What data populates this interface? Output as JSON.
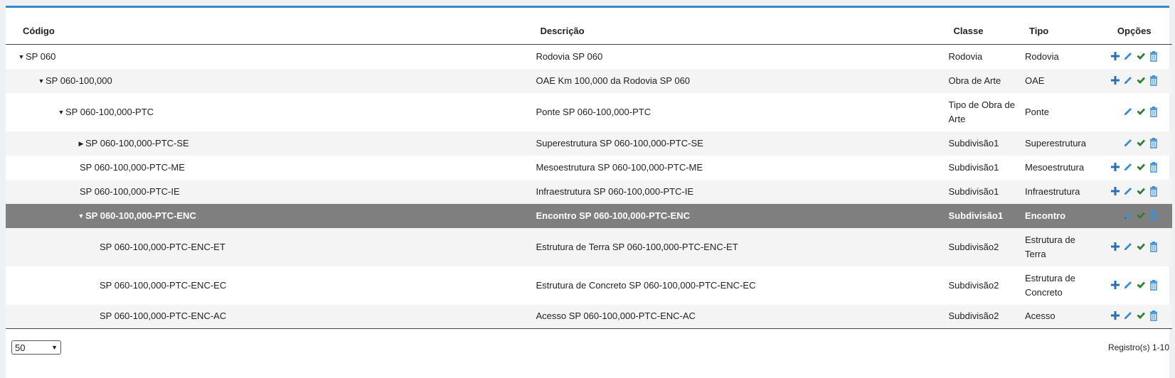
{
  "headers": {
    "codigo": "Código",
    "descricao": "Descrição",
    "classe": "Classe",
    "tipo": "Tipo",
    "opcoes": "Opções"
  },
  "rows": [
    {
      "codigo": "SP 060",
      "descricao": "Rodovia SP 060",
      "classe": "Rodovia",
      "tipo": "Rodovia",
      "expand": "down",
      "level": 0,
      "add": true
    },
    {
      "codigo": "SP 060-100,000",
      "descricao": "OAE Km 100,000 da Rodovia SP 060",
      "classe": "Obra de Arte",
      "tipo": "OAE",
      "expand": "down",
      "level": 1,
      "add": true
    },
    {
      "codigo": "SP 060-100,000-PTC",
      "descricao": "Ponte SP 060-100,000-PTC",
      "classe": "Tipo de Obra de Arte",
      "tipo": "Ponte",
      "expand": "down",
      "level": 2,
      "add": false
    },
    {
      "codigo": "SP 060-100,000-PTC-SE",
      "descricao": "Superestrutura SP 060-100,000-PTC-SE",
      "classe": "Subdivisão1",
      "tipo": "Superestrutura",
      "expand": "right",
      "level": 3,
      "add": false
    },
    {
      "codigo": "SP 060-100,000-PTC-ME",
      "descricao": "Mesoestrutura SP 060-100,000-PTC-ME",
      "classe": "Subdivisão1",
      "tipo": "Mesoestrutura",
      "expand": "none",
      "level": 3,
      "add": true
    },
    {
      "codigo": "SP 060-100,000-PTC-IE",
      "descricao": "Infraestrutura SP 060-100,000-PTC-IE",
      "classe": "Subdivisão1",
      "tipo": "Infraestrutura",
      "expand": "none",
      "level": 3,
      "add": true
    },
    {
      "codigo": "SP 060-100,000-PTC-ENC",
      "descricao": "Encontro SP 060-100,000-PTC-ENC",
      "classe": "Subdivisão1",
      "tipo": "Encontro",
      "expand": "down",
      "level": 3,
      "add": false,
      "selected": true
    },
    {
      "codigo": "SP 060-100,000-PTC-ENC-ET",
      "descricao": "Estrutura de Terra SP 060-100,000-PTC-ENC-ET",
      "classe": "Subdivisão2",
      "tipo": "Estrutura de Terra",
      "expand": "none",
      "level": 4,
      "add": true
    },
    {
      "codigo": "SP 060-100,000-PTC-ENC-EC",
      "descricao": "Estrutura de Concreto SP 060-100,000-PTC-ENC-EC",
      "classe": "Subdivisão2",
      "tipo": "Estrutura de Concreto",
      "expand": "none",
      "level": 4,
      "add": true
    },
    {
      "codigo": "SP 060-100,000-PTC-ENC-AC",
      "descricao": "Acesso SP 060-100,000-PTC-ENC-AC",
      "classe": "Subdivisão2",
      "tipo": "Acesso",
      "expand": "none",
      "level": 4,
      "add": true
    }
  ],
  "footer": {
    "page_size": "50",
    "records": "Registro(s) 1-10"
  },
  "colors": {
    "accent": "#3a87c6",
    "add": "#2a6fb5",
    "edit": "#3b8fd6",
    "check": "#2e7d32",
    "trash": "#3b8fd6",
    "selected_row": "#7f7f7f"
  }
}
